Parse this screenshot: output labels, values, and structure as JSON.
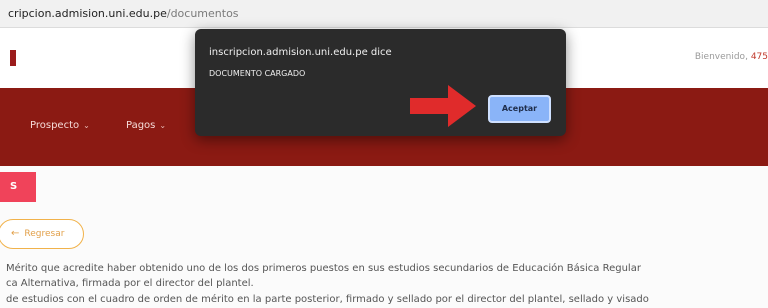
{
  "browser": {
    "url_host": "cripcion.admision.uni.edu.pe",
    "url_path": "/documentos"
  },
  "header": {
    "welcome_label": "Bienvenido,",
    "user_fragment": "475"
  },
  "nav": {
    "items": [
      {
        "label": "Prospecto",
        "chevron": "⌄"
      },
      {
        "label": "Pagos",
        "chevron": "⌄"
      }
    ]
  },
  "content": {
    "section_badge": "S",
    "back_button": {
      "label": "Regresar",
      "icon": "arrow-left-icon"
    },
    "paragraphs": [
      "Mérito que acredite haber obtenido uno de los dos primeros puestos en sus estudios secundarios de Educación Básica Regular",
      "ca Alternativa, firmada por el director del plantel.",
      "de estudios con el cuadro de orden de mérito en la parte posterior, firmado y sellado por el director del plantel, sellado y visado"
    ]
  },
  "dialog": {
    "title": "inscripcion.admision.uni.edu.pe dice",
    "message": "DOCUMENTO CARGADO",
    "ok_label": "Aceptar"
  },
  "colors": {
    "navbar": "#8b1a13",
    "dialog_bg": "#2b2b2b",
    "ok_button": "#8ab4f8",
    "badge": "#f0435a",
    "arrow": "#e02b2b"
  }
}
